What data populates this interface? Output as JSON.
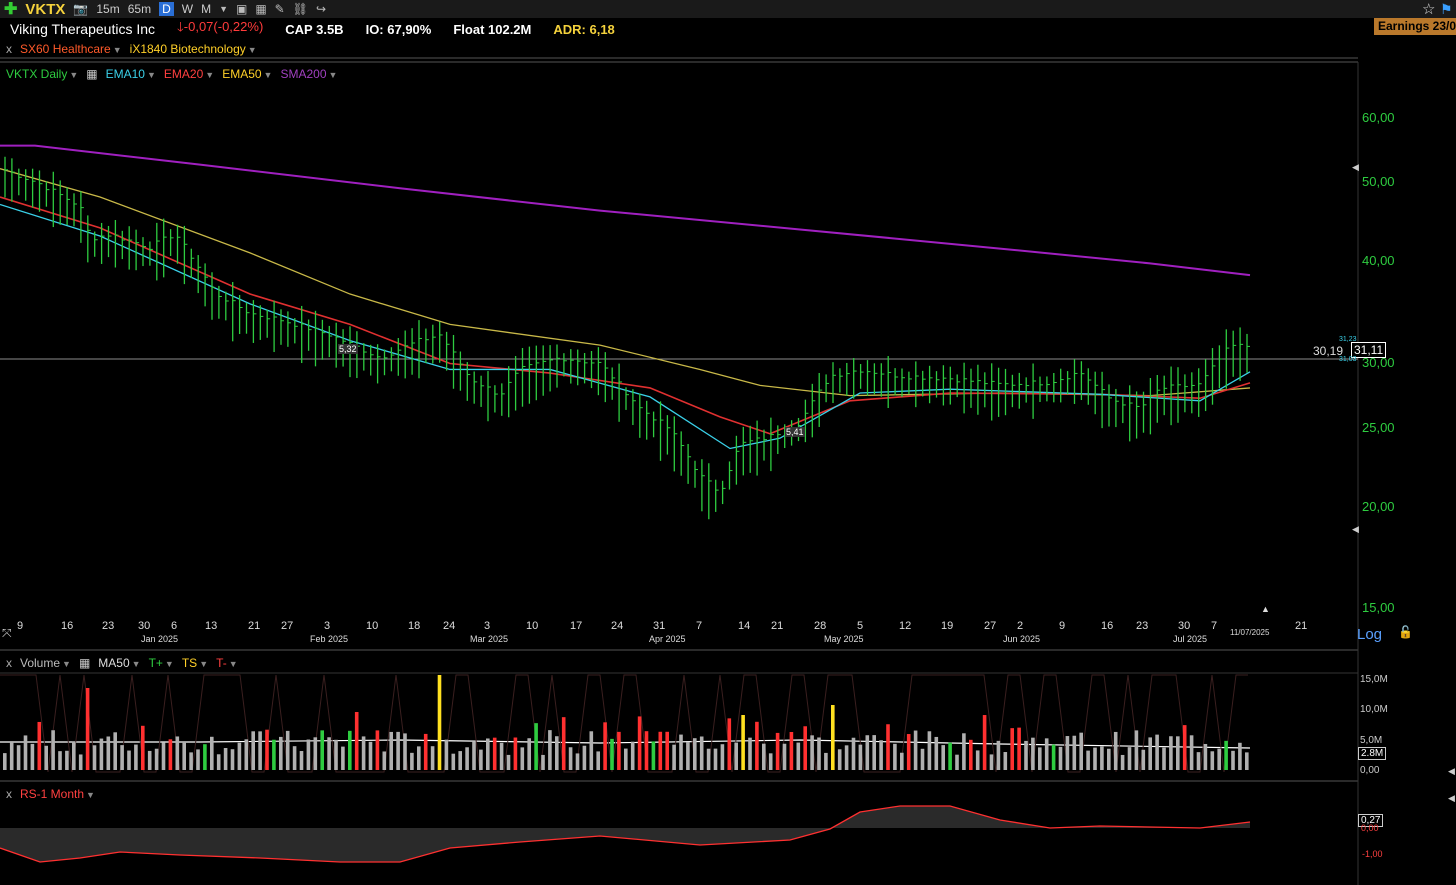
{
  "toolbar": {
    "symbol": "VKTX",
    "timeframes": [
      "15m",
      "65m",
      "D",
      "W",
      "M"
    ],
    "active_timeframe": "D"
  },
  "info": {
    "company": "Viking Therapeutics Inc",
    "change": "-0,07",
    "change_pct": "(-0,22%)",
    "cap": "CAP 3.5B",
    "io": "IO: 67,90%",
    "float": "Float 102.2M",
    "adr": "ADR: 6,18",
    "earnings": "Earnings 23/0"
  },
  "industry": {
    "sector": "SX60 Healthcare",
    "industry": "iX1840 Biotechnology"
  },
  "legend": {
    "symbol": "VKTX Daily",
    "ema10": "EMA10",
    "ema20": "EMA20",
    "ema50": "EMA50",
    "sma200": "SMA200"
  },
  "price_axis": {
    "ticks": [
      "60,00",
      "50,00",
      "40,00",
      "30,00",
      "25,00",
      "20,00",
      "15,00"
    ],
    "tick_values": [
      60,
      50,
      40,
      30,
      25,
      20,
      15
    ],
    "last_price": "31,11",
    "ref_line": "30,19",
    "small_hi": "31,23",
    "small_lo": "31,03",
    "log_label": "Log"
  },
  "date_axis": {
    "days": [
      "9",
      "16",
      "23",
      "30",
      "6",
      "13",
      "21",
      "27",
      "3",
      "10",
      "18",
      "24",
      "3",
      "10",
      "17",
      "24",
      "31",
      "7",
      "14",
      "21",
      "28",
      "5",
      "12",
      "19",
      "27",
      "2",
      "9",
      "16",
      "23",
      "30",
      "7",
      "21"
    ],
    "months": [
      "Jan 2025",
      "Feb 2025",
      "Mar 2025",
      "Apr 2025",
      "May 2025",
      "Jun 2025",
      "Jul 2025"
    ],
    "cursor_date": "11/07/2025"
  },
  "markers": {
    "low_label_1": "5,32",
    "low_label_2": "5,41"
  },
  "volume_panel": {
    "label": "Volume",
    "ma": "MA50",
    "tplus": "T+",
    "ts": "TS",
    "tminus": "T-",
    "ticks": [
      "15,0M",
      "10,0M",
      "5,0M",
      "0,00"
    ],
    "current": "2.8M"
  },
  "rs_panel": {
    "label": "RS-1 Month",
    "current": "0,27",
    "zero": "0,00",
    "low": "-1,00"
  },
  "colors": {
    "up": "#2ecc40",
    "down": "#ff3030",
    "ema10": "#3ad0e8",
    "ema20": "#e03030",
    "ema50": "#c8b848",
    "sma200": "#a020c0"
  }
}
